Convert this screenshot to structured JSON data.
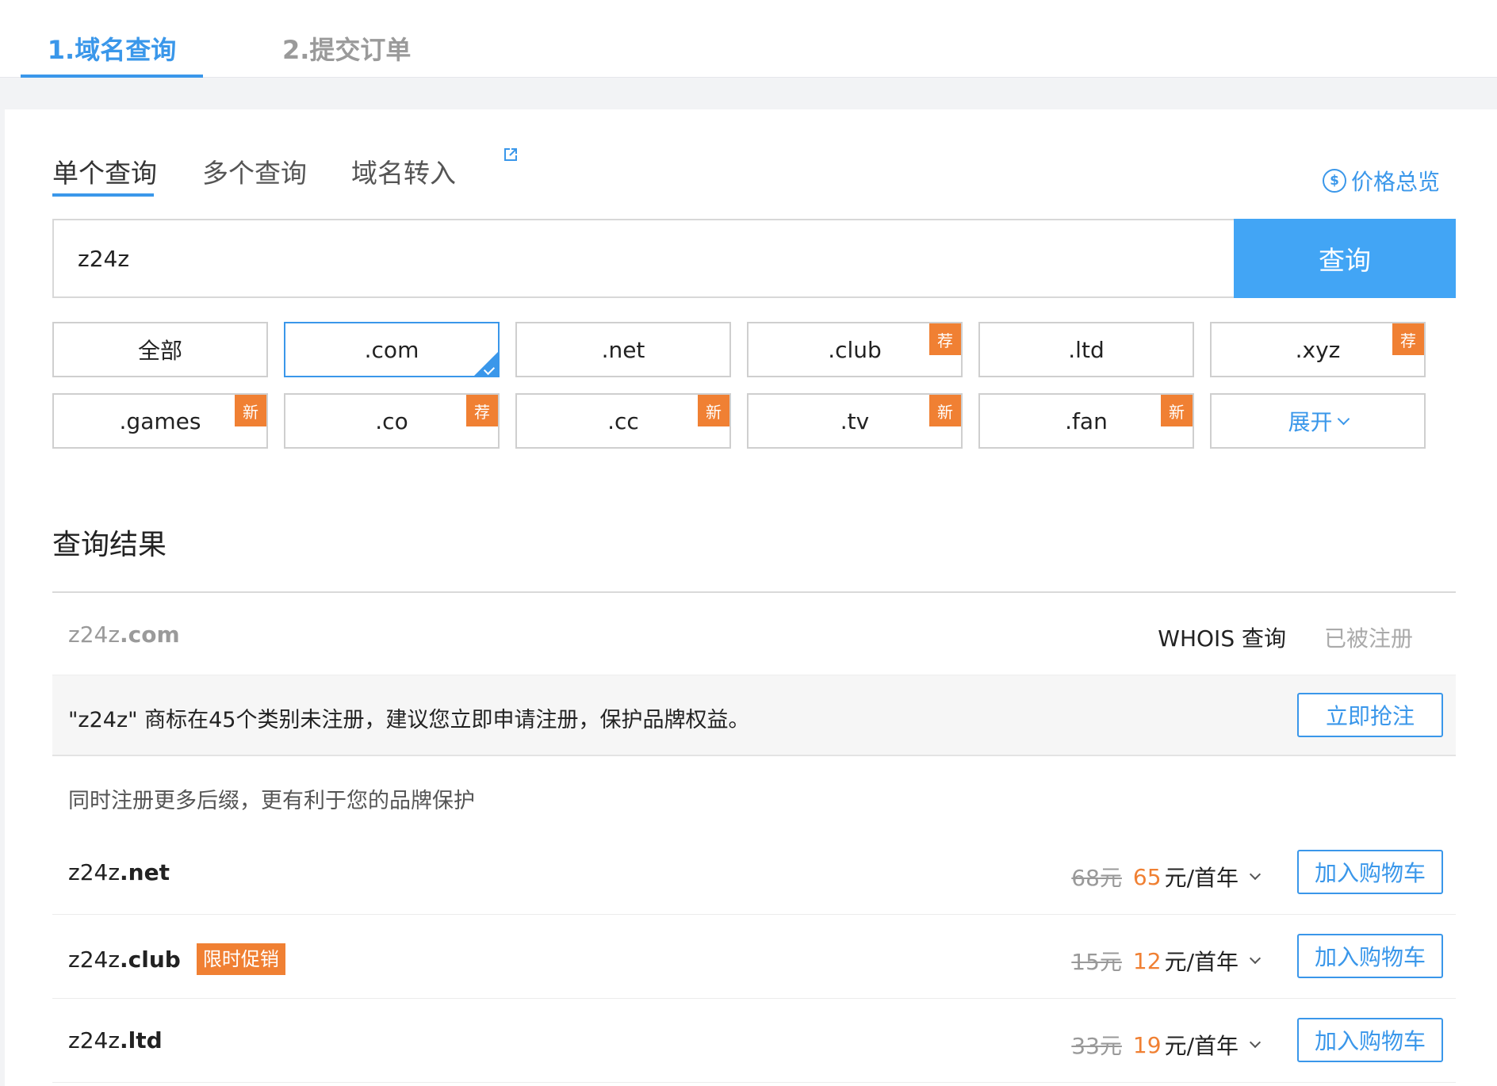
{
  "steps": {
    "step1": "1.域名查询",
    "step2": "2.提交订单"
  },
  "subtabs": {
    "single": "单个查询",
    "multi": "多个查询",
    "transfer": "域名转入"
  },
  "price_overview": {
    "icon": "dollar-circle-icon",
    "label": "价格总览"
  },
  "search": {
    "value": "z24z",
    "button": "查询"
  },
  "tlds": {
    "all": "全部",
    "com": ".com",
    "net": ".net",
    "club": ".club",
    "ltd": ".ltd",
    "xyz": ".xyz",
    "games": ".games",
    "co": ".co",
    "cc": ".cc",
    "tv": ".tv",
    "fan": ".fan",
    "expand": "展开"
  },
  "badges": {
    "recommend": "荐",
    "new": "新"
  },
  "results": {
    "title": "查询结果",
    "main": {
      "name": "z24z",
      "tld": ".com",
      "whois": "WHOIS 查询",
      "status": "已被注册"
    },
    "trademark": {
      "text": "\"z24z\" 商标在45个类别未注册，建议您立即申请注册，保护品牌权益。",
      "button": "立即抢注"
    },
    "suggest_text": "同时注册更多后缀，更有利于您的品牌保护",
    "rows": [
      {
        "name": "z24z",
        "tld": ".net",
        "promo": "",
        "old_price": "68元",
        "new_price": "65",
        "unit": "元/首年",
        "button": "加入购物车"
      },
      {
        "name": "z24z",
        "tld": ".club",
        "promo": "限时促销",
        "old_price": "15元",
        "new_price": "12",
        "unit": "元/首年",
        "button": "加入购物车"
      },
      {
        "name": "z24z",
        "tld": ".ltd",
        "promo": "",
        "old_price": "33元",
        "new_price": "19",
        "unit": "元/首年",
        "button": "加入购物车"
      }
    ]
  },
  "colors": {
    "accent": "#3a97ea",
    "button": "#42a5f5",
    "badge": "#f08033"
  }
}
